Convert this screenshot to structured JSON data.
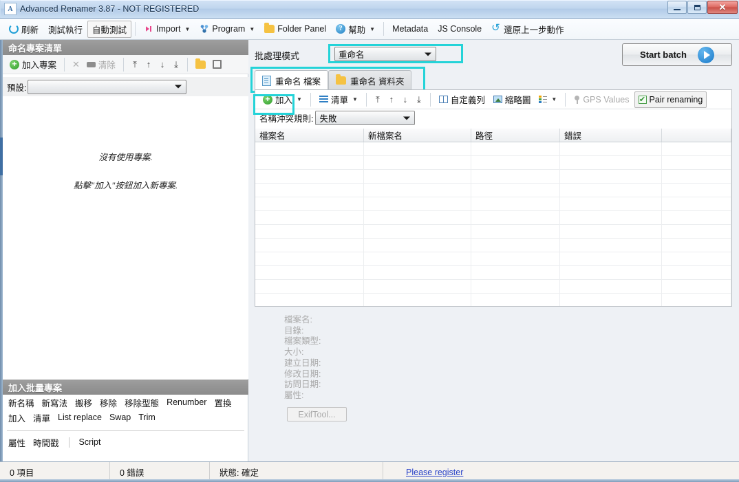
{
  "window": {
    "title": "Advanced Renamer 3.87 - NOT REGISTERED",
    "app_icon": "app-icon",
    "minimize": "–",
    "maximize": "□",
    "close": "X"
  },
  "toolbar": {
    "items": [
      {
        "label": "刷新",
        "icon": "refresh-icon",
        "boxed": false,
        "caret": false
      },
      {
        "label": "測試執行",
        "icon": "none",
        "boxed": false,
        "caret": false
      },
      {
        "label": "自動測試",
        "icon": "none",
        "boxed": true,
        "caret": false
      },
      {
        "label": "Import",
        "icon": "import-icon",
        "boxed": false,
        "caret": true
      },
      {
        "label": "Program",
        "icon": "program-icon",
        "boxed": false,
        "caret": true
      },
      {
        "label": "Folder Panel",
        "icon": "folder-icon",
        "boxed": false,
        "caret": false
      },
      {
        "label": "幫助",
        "icon": "help-icon",
        "boxed": false,
        "caret": true
      },
      {
        "label": "Metadata",
        "icon": "none",
        "boxed": false,
        "caret": false
      },
      {
        "label": "JS Console",
        "icon": "none",
        "boxed": false,
        "caret": false
      },
      {
        "label": "還原上一步動作",
        "icon": "undo-icon",
        "boxed": false,
        "caret": false
      }
    ]
  },
  "project_panel": {
    "header": "命名專案清單",
    "toolbar": {
      "add_project": "加入專案",
      "delete_icon": "x-icon",
      "clear": "清除",
      "move_top_icon": "move-to-top-icon",
      "move_up_icon": "move-up-icon",
      "move_down_icon": "move-down-icon",
      "move_bottom_icon": "move-to-bottom-icon",
      "open_icon": "folder-open-icon",
      "save_icon": "save-icon"
    },
    "preset_label": "預設:",
    "preset_value": "",
    "empty_line1": "沒有使用專案.",
    "empty_line2": "點擊\"加入\"按鈕加入新專案."
  },
  "batch_panel": {
    "header": "加入批量專案",
    "row1": [
      "新名稱",
      "新寫法",
      "搬移",
      "移除",
      "移除型態",
      "Renumber",
      "置換"
    ],
    "row2": [
      "加入",
      "清單",
      "List replace",
      "Swap",
      "Trim"
    ],
    "row3": [
      "屬性",
      "時間戳",
      "Script"
    ]
  },
  "mode": {
    "label": "批處理模式",
    "value": "重命名",
    "highlight_color": "#24d3d8"
  },
  "start_batch": {
    "label": "Start batch",
    "icon": "play-icon"
  },
  "tabs": [
    {
      "label": "重命名 檔案",
      "icon": "document-icon",
      "active": true
    },
    {
      "label": "重命名 資料夾",
      "icon": "folder-icon",
      "active": false
    }
  ],
  "file_toolbar": {
    "add": "加入",
    "list": "清單",
    "move_top_icon": "move-to-top-icon",
    "move_up_icon": "move-up-icon",
    "move_down_icon": "move-down-icon",
    "move_bottom_icon": "move-to-bottom-icon",
    "custom_columns": "自定義列",
    "thumbnails": "縮略圖",
    "detail_icon": "detail-view-icon",
    "gps_values": "GPS Values",
    "pair_renaming": "Pair renaming"
  },
  "conflict": {
    "label": "名稱沖突規則:",
    "value": "失敗"
  },
  "grid": {
    "columns": [
      "檔案名",
      "新檔案名",
      "路徑",
      "錯誤",
      ""
    ],
    "rows": []
  },
  "info": {
    "lines": [
      "檔案名:",
      "目錄:",
      "檔案類型:",
      "大小:",
      "建立日期:",
      "修改日期:",
      "訪問日期:",
      "屬性:"
    ],
    "exiftool_button": "ExifTool..."
  },
  "statusbar": {
    "items": "0 項目",
    "errors": "0 錯誤",
    "status": "狀態: 確定",
    "register_link": "Please register"
  }
}
